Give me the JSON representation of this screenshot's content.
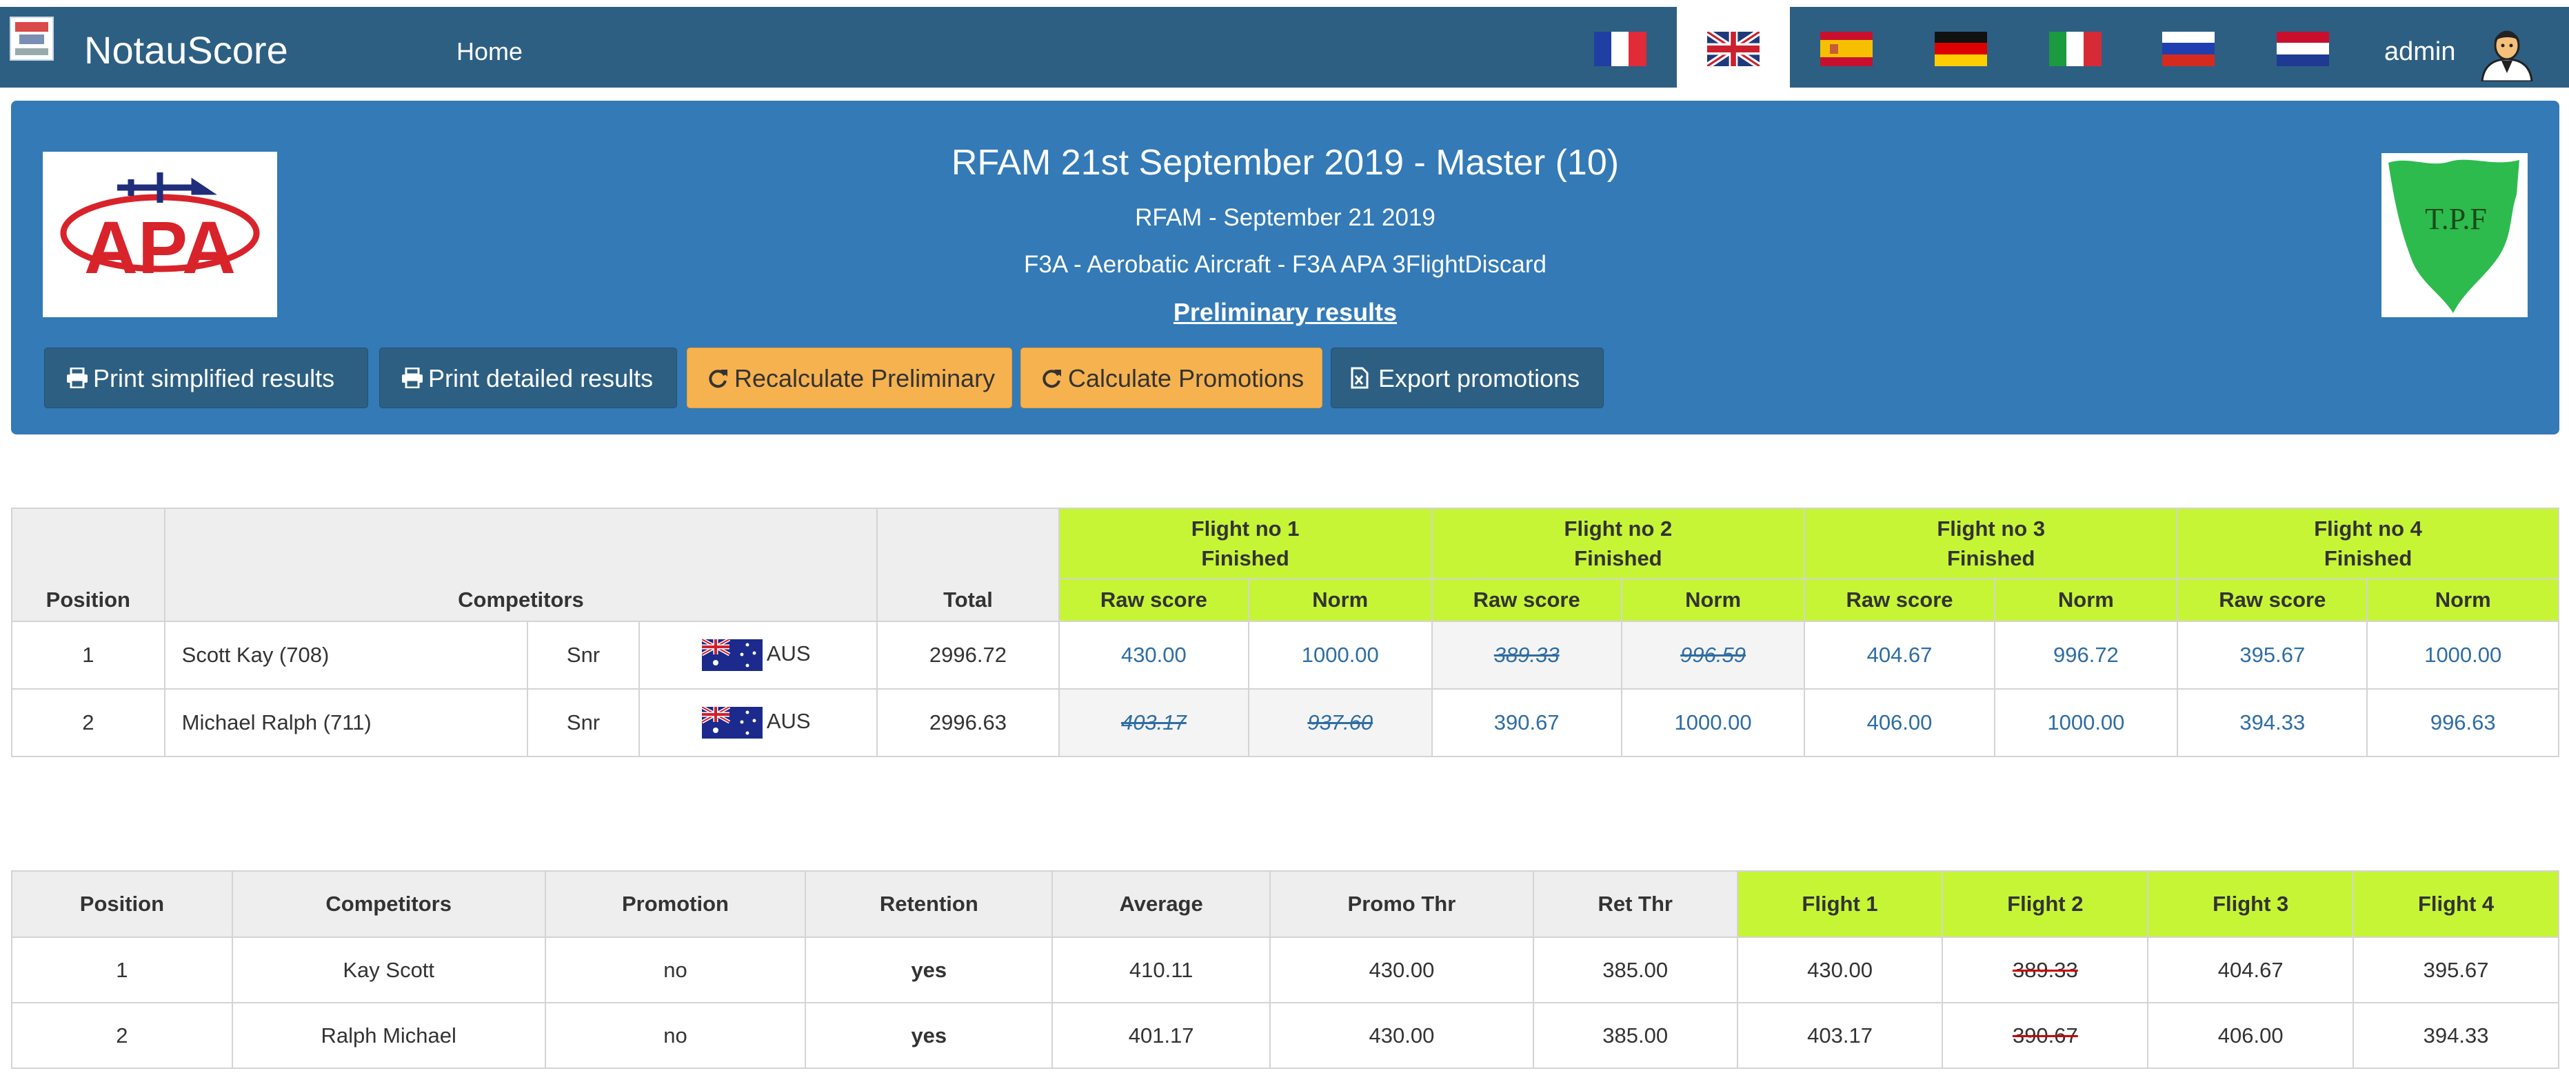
{
  "app": {
    "brand": "NotauScore"
  },
  "nav": {
    "home": "Home",
    "user": "admin",
    "languages": [
      "fr",
      "en",
      "es",
      "de",
      "it",
      "ru",
      "nl"
    ],
    "active_language": "en"
  },
  "event": {
    "title": "RFAM 21st September 2019 - Master (10)",
    "subtitle": "RFAM - September 21 2019",
    "category": "F3A - Aerobatic Aircraft - F3A APA 3FlightDiscard",
    "results_link": "Preliminary results",
    "logo_left_text": "APA",
    "logo_right_text": "T.P.F"
  },
  "buttons": {
    "print_simplified": "Print simplified results",
    "print_detailed": "Print detailed results",
    "recalc": "Recalculate Preliminary",
    "calc_promotions": "Calculate Promotions",
    "export_promotions": "Export promotions"
  },
  "results": {
    "headers": {
      "position": "Position",
      "competitors": "Competitors",
      "total": "Total",
      "raw": "Raw score",
      "norm": "Norm"
    },
    "flights": [
      {
        "name": "Flight no 1",
        "status": "Finished"
      },
      {
        "name": "Flight no 2",
        "status": "Finished"
      },
      {
        "name": "Flight no 3",
        "status": "Finished"
      },
      {
        "name": "Flight no 4",
        "status": "Finished"
      }
    ],
    "rows": [
      {
        "position": "1",
        "name": "Scott Kay (708)",
        "class": "Snr",
        "country": "AUS",
        "total": "2996.72",
        "f1_raw": "430.00",
        "f1_norm": "1000.00",
        "f2_raw": "389.33",
        "f2_norm": "996.59",
        "f3_raw": "404.67",
        "f3_norm": "996.72",
        "f4_raw": "395.67",
        "f4_norm": "1000.00"
      },
      {
        "position": "2",
        "name": "Michael Ralph (711)",
        "class": "Snr",
        "country": "AUS",
        "total": "2996.63",
        "f1_raw": "403.17",
        "f1_norm": "937.60",
        "f2_raw": "390.67",
        "f2_norm": "1000.00",
        "f3_raw": "406.00",
        "f3_norm": "1000.00",
        "f4_raw": "394.33",
        "f4_norm": "996.63"
      }
    ]
  },
  "promotions": {
    "headers": {
      "position": "Position",
      "competitors": "Competitors",
      "promotion": "Promotion",
      "retention": "Retention",
      "average": "Average",
      "promo_thr": "Promo Thr",
      "ret_thr": "Ret Thr",
      "flight1": "Flight 1",
      "flight2": "Flight 2",
      "flight3": "Flight 3",
      "flight4": "Flight 4"
    },
    "rows": [
      {
        "position": "1",
        "name": "Kay Scott",
        "promotion": "no",
        "retention": "yes",
        "average": "410.11",
        "promo_thr": "430.00",
        "ret_thr": "385.00",
        "f1": "430.00",
        "f2": "389.33",
        "f3": "404.67",
        "f4": "395.67"
      },
      {
        "position": "2",
        "name": "Ralph Michael",
        "promotion": "no",
        "retention": "yes",
        "average": "401.17",
        "promo_thr": "430.00",
        "ret_thr": "385.00",
        "f1": "403.17",
        "f2": "390.67",
        "f3": "406.00",
        "f4": "394.33"
      }
    ]
  }
}
